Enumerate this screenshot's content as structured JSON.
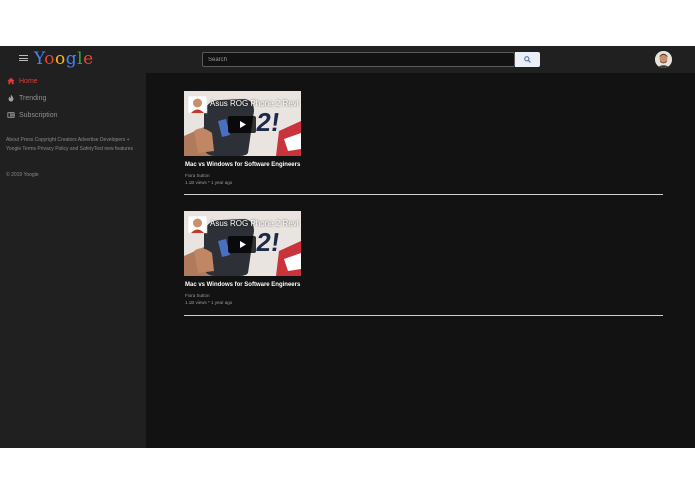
{
  "header": {
    "logo_letters": [
      {
        "char": "Y",
        "color": "#4285f4"
      },
      {
        "char": "o",
        "color": "#ea4335"
      },
      {
        "char": "o",
        "color": "#fbbc05"
      },
      {
        "char": "g",
        "color": "#4285f4"
      },
      {
        "char": "l",
        "color": "#34a853"
      },
      {
        "char": "e",
        "color": "#ea4335"
      }
    ],
    "search_placeholder": "Search",
    "menu_icon": "hamburger-icon",
    "search_icon": "magnifier-icon"
  },
  "sidebar": {
    "items": [
      {
        "label": "Home",
        "icon": "home-icon",
        "active": true
      },
      {
        "label": "Trending",
        "icon": "flame-icon",
        "active": false
      },
      {
        "label": "Subscription",
        "icon": "subscriptions-icon",
        "active": false
      }
    ],
    "footer_links": "About Press Copyright Creators Advertise Developers + Yoogle Terms Privacy Policy and SafetyTest new features",
    "copyright": "© 2019 Yoogle"
  },
  "videos": [
    {
      "thumbnail_title": "Asus ROG Phone 2 Revi",
      "thumbnail_badge": "2!",
      "title": "Mac vs Windows for Software Engineers",
      "channel": "Fiora Sutton",
      "meta": "1.1B views * 1 year ago"
    },
    {
      "thumbnail_title": "Asus ROG Phone 2 Revi",
      "thumbnail_badge": "2!",
      "title": "Mac vs Windows for Software Engineers",
      "channel": "Fiora Sutton",
      "meta": "1.1B views * 1 year ago"
    }
  ],
  "colors": {
    "accent": "#e53935",
    "background": "#121212",
    "surface": "#202020"
  }
}
